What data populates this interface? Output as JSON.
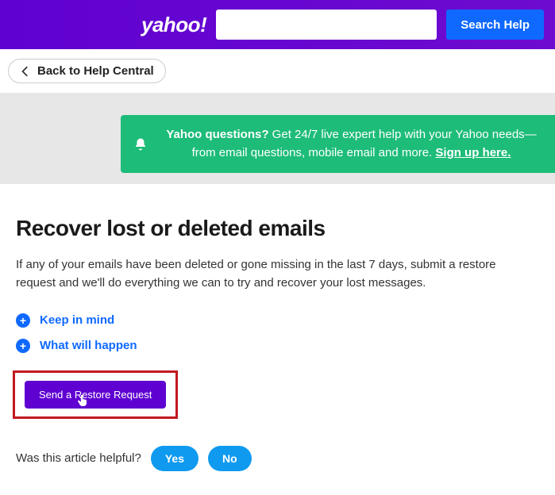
{
  "header": {
    "logo_text": "yahoo!",
    "search_placeholder": "",
    "search_button_label": "Search Help"
  },
  "back_nav": {
    "label": "Back to Help Central"
  },
  "banner": {
    "strong_text": "Yahoo questions?",
    "body_text": " Get 24/7 live expert help with your Yahoo needs—from email questions, mobile email and more. ",
    "signup_text": "Sign up here."
  },
  "article": {
    "title": "Recover lost or deleted emails",
    "intro": "If any of your emails have been deleted or gone missing in the last 7 days, submit a restore request and we'll do everything we can to try and recover your lost messages.",
    "expanders": [
      {
        "label": "Keep in mind"
      },
      {
        "label": "What will happen"
      }
    ],
    "restore_button_label": "Send a Restore Request"
  },
  "feedback": {
    "question": "Was this article helpful?",
    "yes_label": "Yes",
    "no_label": "No"
  }
}
